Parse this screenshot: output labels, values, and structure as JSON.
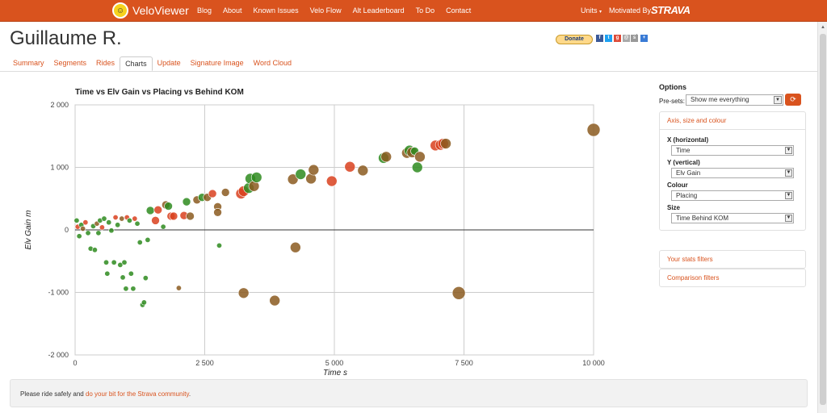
{
  "topbar": {
    "app_name": "VeloViewer",
    "nav": [
      "Blog",
      "About",
      "Known Issues",
      "Velo Flow",
      "Alt Leaderboard",
      "To Do",
      "Contact"
    ],
    "units_label": "Units",
    "motivated_by": "Motivated By",
    "strava": "STRAVA",
    "color": "#d9531e"
  },
  "athlete_name": "Guillaume R.",
  "donate_label": "Donate",
  "tabs": [
    "Summary",
    "Segments",
    "Rides",
    "Charts",
    "Update",
    "Signature Image",
    "Word Cloud"
  ],
  "active_tab": "Charts",
  "options": {
    "title": "Options",
    "presets_label": "Pre-sets:",
    "presets_value": "Show me everything",
    "axis_panel_title": "Axis, size and colour",
    "x_label": "X (horizontal)",
    "x_value": "Time",
    "y_label": "Y (vertical)",
    "y_value": "Elv Gain",
    "colour_label": "Colour",
    "colour_value": "Placing",
    "size_label": "Size",
    "size_value": "Time Behind KOM",
    "stats_filters": "Your stats filters",
    "comparison_filters": "Comparison filters"
  },
  "footer": {
    "prefix": "Please ride safely and ",
    "link": "do your bit for the Strava community",
    "suffix": "."
  },
  "chart_data": {
    "type": "scatter",
    "title": "Time vs Elv Gain vs Placing vs Behind KOM",
    "xlabel": "Time s",
    "ylabel": "Elv Gain m",
    "xlim": [
      0,
      10000
    ],
    "ylim": [
      -2000,
      2000
    ],
    "xticks": [
      "0",
      "2 500",
      "5 000",
      "7 500",
      "10 000"
    ],
    "yticks": [
      "2 000",
      "1 000",
      "0",
      "-1 000",
      "-2 000"
    ],
    "grid": true,
    "colors": {
      "good": "#2e8b1e",
      "mid": "#8b5a20",
      "bad": "#d9411e"
    },
    "points": [
      {
        "x": 30,
        "y": 150,
        "c": "good",
        "s": 1
      },
      {
        "x": 50,
        "y": 50,
        "c": "bad",
        "s": 1
      },
      {
        "x": 80,
        "y": -100,
        "c": "good",
        "s": 1
      },
      {
        "x": 120,
        "y": 80,
        "c": "good",
        "s": 1
      },
      {
        "x": 150,
        "y": 20,
        "c": "mid",
        "s": 1
      },
      {
        "x": 200,
        "y": 120,
        "c": "bad",
        "s": 1
      },
      {
        "x": 250,
        "y": -50,
        "c": "good",
        "s": 1
      },
      {
        "x": 300,
        "y": -300,
        "c": "good",
        "s": 1
      },
      {
        "x": 350,
        "y": 60,
        "c": "good",
        "s": 1
      },
      {
        "x": 380,
        "y": -320,
        "c": "good",
        "s": 1
      },
      {
        "x": 420,
        "y": 100,
        "c": "mid",
        "s": 1
      },
      {
        "x": 450,
        "y": -50,
        "c": "good",
        "s": 1
      },
      {
        "x": 480,
        "y": 150,
        "c": "good",
        "s": 1
      },
      {
        "x": 520,
        "y": 40,
        "c": "bad",
        "s": 1
      },
      {
        "x": 560,
        "y": 180,
        "c": "good",
        "s": 1
      },
      {
        "x": 600,
        "y": -520,
        "c": "good",
        "s": 1
      },
      {
        "x": 620,
        "y": -700,
        "c": "good",
        "s": 1
      },
      {
        "x": 650,
        "y": 120,
        "c": "good",
        "s": 1
      },
      {
        "x": 700,
        "y": -10,
        "c": "good",
        "s": 1
      },
      {
        "x": 750,
        "y": -520,
        "c": "good",
        "s": 1
      },
      {
        "x": 780,
        "y": 200,
        "c": "bad",
        "s": 1
      },
      {
        "x": 820,
        "y": 80,
        "c": "good",
        "s": 1
      },
      {
        "x": 870,
        "y": -560,
        "c": "good",
        "s": 1
      },
      {
        "x": 900,
        "y": 180,
        "c": "mid",
        "s": 1
      },
      {
        "x": 920,
        "y": -760,
        "c": "good",
        "s": 1
      },
      {
        "x": 950,
        "y": -520,
        "c": "good",
        "s": 1
      },
      {
        "x": 980,
        "y": -940,
        "c": "good",
        "s": 1
      },
      {
        "x": 1000,
        "y": 200,
        "c": "bad",
        "s": 1
      },
      {
        "x": 1050,
        "y": 150,
        "c": "good",
        "s": 1
      },
      {
        "x": 1080,
        "y": -700,
        "c": "good",
        "s": 1
      },
      {
        "x": 1120,
        "y": -940,
        "c": "good",
        "s": 1
      },
      {
        "x": 1150,
        "y": 180,
        "c": "bad",
        "s": 1
      },
      {
        "x": 1200,
        "y": 100,
        "c": "good",
        "s": 1
      },
      {
        "x": 1250,
        "y": -200,
        "c": "good",
        "s": 1
      },
      {
        "x": 1300,
        "y": -1200,
        "c": "good",
        "s": 1
      },
      {
        "x": 1330,
        "y": -1160,
        "c": "good",
        "s": 1
      },
      {
        "x": 1360,
        "y": -770,
        "c": "good",
        "s": 1
      },
      {
        "x": 1400,
        "y": -160,
        "c": "good",
        "s": 1
      },
      {
        "x": 1450,
        "y": 310,
        "c": "good",
        "s": 2
      },
      {
        "x": 1550,
        "y": 150,
        "c": "bad",
        "s": 2
      },
      {
        "x": 1600,
        "y": 320,
        "c": "bad",
        "s": 2
      },
      {
        "x": 1700,
        "y": 50,
        "c": "good",
        "s": 1
      },
      {
        "x": 1750,
        "y": 400,
        "c": "mid",
        "s": 2
      },
      {
        "x": 1800,
        "y": 380,
        "c": "good",
        "s": 2
      },
      {
        "x": 1850,
        "y": 220,
        "c": "bad",
        "s": 2
      },
      {
        "x": 1900,
        "y": 220,
        "c": "bad",
        "s": 2
      },
      {
        "x": 2000,
        "y": -930,
        "c": "mid",
        "s": 1
      },
      {
        "x": 2100,
        "y": 230,
        "c": "bad",
        "s": 2
      },
      {
        "x": 2150,
        "y": 450,
        "c": "good",
        "s": 2
      },
      {
        "x": 2220,
        "y": 220,
        "c": "mid",
        "s": 2
      },
      {
        "x": 2350,
        "y": 480,
        "c": "mid",
        "s": 2
      },
      {
        "x": 2450,
        "y": 520,
        "c": "good",
        "s": 2
      },
      {
        "x": 2550,
        "y": 520,
        "c": "mid",
        "s": 2
      },
      {
        "x": 2650,
        "y": 580,
        "c": "bad",
        "s": 2
      },
      {
        "x": 2750,
        "y": 370,
        "c": "mid",
        "s": 2
      },
      {
        "x": 2750,
        "y": 280,
        "c": "mid",
        "s": 2
      },
      {
        "x": 2780,
        "y": -250,
        "c": "good",
        "s": 1
      },
      {
        "x": 2900,
        "y": 600,
        "c": "mid",
        "s": 2
      },
      {
        "x": 3200,
        "y": 580,
        "c": "bad",
        "s": 3
      },
      {
        "x": 3250,
        "y": 620,
        "c": "bad",
        "s": 3
      },
      {
        "x": 3250,
        "y": -1010,
        "c": "mid",
        "s": 3
      },
      {
        "x": 3350,
        "y": 670,
        "c": "good",
        "s": 3
      },
      {
        "x": 3380,
        "y": 820,
        "c": "good",
        "s": 3
      },
      {
        "x": 3450,
        "y": 700,
        "c": "mid",
        "s": 3
      },
      {
        "x": 3500,
        "y": 840,
        "c": "good",
        "s": 3
      },
      {
        "x": 3850,
        "y": -1130,
        "c": "mid",
        "s": 3
      },
      {
        "x": 4200,
        "y": 810,
        "c": "mid",
        "s": 3
      },
      {
        "x": 4250,
        "y": -280,
        "c": "mid",
        "s": 3
      },
      {
        "x": 4350,
        "y": 890,
        "c": "good",
        "s": 3
      },
      {
        "x": 4550,
        "y": 820,
        "c": "mid",
        "s": 3
      },
      {
        "x": 4600,
        "y": 960,
        "c": "mid",
        "s": 3
      },
      {
        "x": 4950,
        "y": 780,
        "c": "bad",
        "s": 3
      },
      {
        "x": 5300,
        "y": 1010,
        "c": "bad",
        "s": 3
      },
      {
        "x": 5550,
        "y": 950,
        "c": "mid",
        "s": 3
      },
      {
        "x": 5950,
        "y": 1150,
        "c": "good",
        "s": 3
      },
      {
        "x": 6000,
        "y": 1170,
        "c": "mid",
        "s": 3
      },
      {
        "x": 6400,
        "y": 1230,
        "c": "mid",
        "s": 3
      },
      {
        "x": 6450,
        "y": 1270,
        "c": "good",
        "s": 3
      },
      {
        "x": 6500,
        "y": 1240,
        "c": "mid",
        "s": 3
      },
      {
        "x": 6550,
        "y": 1260,
        "c": "good",
        "s": 2
      },
      {
        "x": 6600,
        "y": 1000,
        "c": "good",
        "s": 3
      },
      {
        "x": 6650,
        "y": 1170,
        "c": "mid",
        "s": 3
      },
      {
        "x": 6950,
        "y": 1350,
        "c": "bad",
        "s": 3
      },
      {
        "x": 7050,
        "y": 1360,
        "c": "bad",
        "s": 3
      },
      {
        "x": 7100,
        "y": 1380,
        "c": "bad",
        "s": 3
      },
      {
        "x": 7150,
        "y": 1380,
        "c": "mid",
        "s": 3
      },
      {
        "x": 7400,
        "y": -1010,
        "c": "mid",
        "s": 4
      },
      {
        "x": 10000,
        "y": 1600,
        "c": "mid",
        "s": 4
      }
    ]
  }
}
